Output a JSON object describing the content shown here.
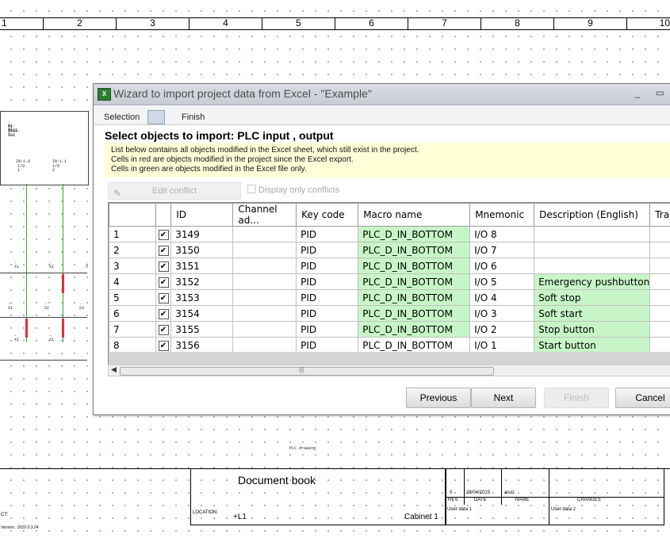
{
  "ruler": [
    "1",
    "2",
    "3",
    "4",
    "5",
    "6",
    "7",
    "8",
    "9",
    "10"
  ],
  "schematic": {
    "module": [
      "-N1-N1",
      "N1 SLOT 1",
      "1734-IB8"
    ],
    "inputs": [
      {
        "label": "IN:1.0",
        "io": "I/O 1"
      },
      {
        "label": "IN:1.1",
        "io": "I/O 2"
      }
    ],
    "terminals": [
      "-X1",
      "-X1",
      "-X"
    ],
    "switches": [
      "-S1",
      "-S2",
      "-S3"
    ],
    "plc_drawing": "PLC drawing"
  },
  "title_block": {
    "document": "Document book",
    "rev": "0",
    "date": "28/04/2015",
    "name": "aruiz",
    "rev_label": "REV.",
    "date_label": "DATE",
    "name_label": "NAME",
    "changes_label": "CHANGES",
    "user_data_1": "User data 1",
    "user_data_2": "User data 2",
    "location_label": "LOCATION:",
    "location": "+L1",
    "cabinet": "Cabinet 1",
    "ct_label": "CT:",
    "version": "Version : 2015.0.3.24"
  },
  "dialog": {
    "title": "Wizard to import project data from Excel - \"Example\"",
    "window_controls": "_ ▭",
    "tabs": {
      "selection": "Selection",
      "finish": "Finish"
    },
    "header": "Select objects to import: PLC input , output",
    "info": [
      "List below contains all objects modified in the Excel sheet, which still exist in the project.",
      "Cells in red are objects modified in the project since the Excel export.",
      "Cells in green are objects modified in the Excel file only."
    ],
    "edit_conflict": "Edit conflict",
    "display_only_conflicts": "Display only conflicts",
    "columns": [
      "",
      "",
      "ID",
      "Channel ad...",
      "Key code",
      "Macro name",
      "Mnemonic",
      "Description (English)",
      "Tra"
    ],
    "rows": [
      {
        "n": "1",
        "id": "3149",
        "channel": "",
        "key": "PID",
        "macro": "PLC_D_IN_BOTTOM",
        "mnemonic": "I/O 8",
        "desc": ""
      },
      {
        "n": "2",
        "id": "3150",
        "channel": "",
        "key": "PID",
        "macro": "PLC_D_IN_BOTTOM",
        "mnemonic": "I/O 7",
        "desc": ""
      },
      {
        "n": "3",
        "id": "3151",
        "channel": "",
        "key": "PID",
        "macro": "PLC_D_IN_BOTTOM",
        "mnemonic": "I/O 6",
        "desc": ""
      },
      {
        "n": "4",
        "id": "3152",
        "channel": "",
        "key": "PID",
        "macro": "PLC_D_IN_BOTTOM",
        "mnemonic": "I/O 5",
        "desc": "Emergency pushbutton"
      },
      {
        "n": "5",
        "id": "3153",
        "channel": "",
        "key": "PID",
        "macro": "PLC_D_IN_BOTTOM",
        "mnemonic": "I/O 4",
        "desc": "Soft stop"
      },
      {
        "n": "6",
        "id": "3154",
        "channel": "",
        "key": "PID",
        "macro": "PLC_D_IN_BOTTOM",
        "mnemonic": "I/O 3",
        "desc": "Soft start"
      },
      {
        "n": "7",
        "id": "3155",
        "channel": "",
        "key": "PID",
        "macro": "PLC_D_IN_BOTTOM",
        "mnemonic": "I/O 2",
        "desc": "Stop button"
      },
      {
        "n": "8",
        "id": "3156",
        "channel": "",
        "key": "PID",
        "macro": "PLC_D_IN_BOTTOM",
        "mnemonic": "I/O 1",
        "desc": "Start button"
      }
    ],
    "checkmark": "✔",
    "buttons": {
      "previous": "Previous",
      "next": "Next",
      "finish": "Finish",
      "cancel": "Cancel"
    }
  },
  "colors": {
    "green_cell": "#c8f5c8",
    "info_bg": "#ffffd8"
  }
}
